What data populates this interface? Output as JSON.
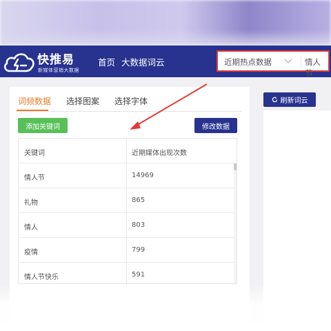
{
  "logo": {
    "title": "快推易",
    "subtitle": "新媒体营销大数据"
  },
  "nav": {
    "home": "首页",
    "wordcloud": "大数据词云"
  },
  "select": {
    "value": "近期热点数据",
    "tag": "情人节"
  },
  "tabs": [
    {
      "label": "词频数据"
    },
    {
      "label": "选择图案"
    },
    {
      "label": "选择字体"
    }
  ],
  "buttons": {
    "add_keyword": "添加关键词",
    "edit_data": "修改数据",
    "refresh": "刷新词云"
  },
  "table": {
    "headers": {
      "keyword": "关键词",
      "count": "近期媒体出现次数"
    },
    "rows": [
      {
        "keyword": "情人节",
        "count": "14969"
      },
      {
        "keyword": "礼物",
        "count": "865"
      },
      {
        "keyword": "情人",
        "count": "803"
      },
      {
        "keyword": "疫情",
        "count": "799"
      },
      {
        "keyword": "情人节快乐",
        "count": "591"
      }
    ]
  },
  "colors": {
    "nav": "#27338f",
    "accent": "#e8792b",
    "green": "#58c058",
    "annotation": "#e53935"
  },
  "icons": {
    "logo": "cloud-logo-icon",
    "dropdown": "chevron-down-icon",
    "refresh": "refresh-icon"
  }
}
